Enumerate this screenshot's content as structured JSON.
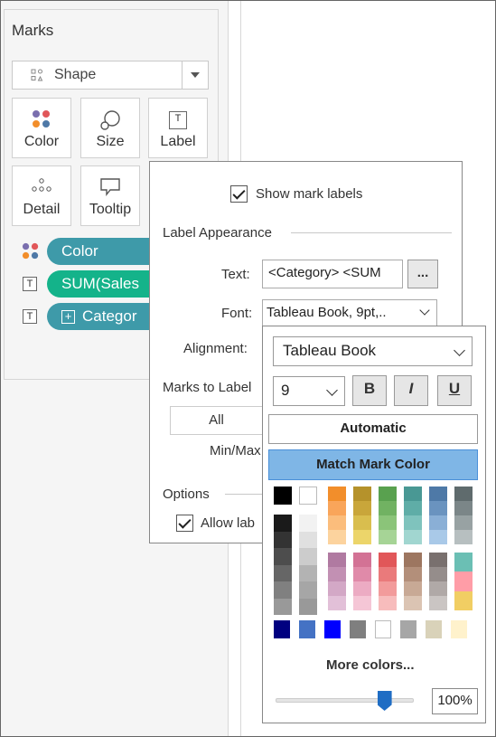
{
  "marks": {
    "title": "Marks",
    "mark_type": "Shape",
    "buttons": [
      "Color",
      "Size",
      "Label",
      "Detail",
      "Tooltip"
    ],
    "pills": [
      {
        "icon": "color-dots-icon",
        "label": "Color",
        "color": "#3e9aa9"
      },
      {
        "icon": "text-icon",
        "label": "SUM(Sales",
        "color": "#14b38a"
      },
      {
        "icon": "text-icon",
        "label": "Categor",
        "color": "#3e9aa9"
      }
    ]
  },
  "label_popup": {
    "show_mark_labels": "Show mark labels",
    "label_appearance": "Label Appearance",
    "text_label": "Text:",
    "text_value": "<Category> <SUM",
    "dots": "...",
    "font_label": "Font:",
    "font_value": "Tableau Book, 9pt,..",
    "alignment_label": "Alignment:",
    "marks_to_label": "Marks to Label",
    "all_button": "All",
    "min_max": "Min/Max",
    "options": "Options",
    "allow_labels": "Allow lab"
  },
  "font_popup": {
    "font_family": "Tableau Book",
    "font_size": "9",
    "bold": "B",
    "italic": "I",
    "underline": "U",
    "automatic": "Automatic",
    "match_mark_color": "Match Mark Color",
    "more_colors": "More colors...",
    "opacity_value": 80,
    "opacity": "100%",
    "colors": {
      "grays_top": [
        "#000000",
        "#ffffff"
      ],
      "gray_col1": [
        "#1a1a1a",
        "#333333",
        "#4d4d4d",
        "#666666",
        "#808080",
        "#999999"
      ],
      "gray_col2": [
        "#f2f2f2",
        "#e0e0e0",
        "#cccccc",
        "#b3b3b3",
        "#a6a6a6",
        "#999999"
      ],
      "palette_top": [
        [
          "#f28e2b",
          "#f9a55a",
          "#fbbd7c",
          "#fcd39e"
        ],
        [
          "#b5922b",
          "#c9a63a",
          "#d9be4e",
          "#ecd56a"
        ],
        [
          "#59a14f",
          "#71b262",
          "#8bc479",
          "#a6d496"
        ],
        [
          "#499894",
          "#5fada7",
          "#7fc3bd",
          "#a1d6d0"
        ],
        [
          "#4e79a7",
          "#6a93bf",
          "#8aafd6",
          "#a9c9e8"
        ],
        [
          "#5f6b6d",
          "#7b8688",
          "#98a2a3",
          "#b7bfc0"
        ]
      ],
      "palette_bottom": [
        [
          "#b07aa1",
          "#c290b3",
          "#d3a8c6",
          "#e2c0d8"
        ],
        [
          "#d37295",
          "#e08aa9",
          "#ecabc3",
          "#f5c6d6"
        ],
        [
          "#e15759",
          "#ea7a7b",
          "#f29b9b",
          "#f7bcbc"
        ],
        [
          "#9d7660",
          "#b38f7a",
          "#c8a995",
          "#dbc4b3"
        ],
        [
          "#79706e",
          "#958d8b",
          "#b0a9a7",
          "#cac5c3"
        ],
        [
          "#6bbfb4",
          "#ff9da7",
          "#f1ce63"
        ]
      ],
      "bottom_row": [
        "#000080",
        "#4472c4",
        "#0000ff",
        "#7f7f7f",
        "#ffffff",
        "#a6a6a6",
        "#d9d2b9",
        "#fff2cc"
      ]
    }
  }
}
